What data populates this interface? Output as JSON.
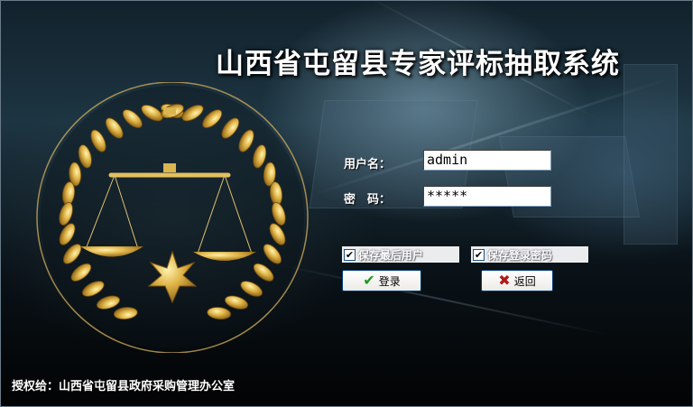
{
  "title": "山西省屯留县专家评标抽取系统",
  "form": {
    "username_label": "用户名：",
    "username_value": "admin",
    "password_label": "密　码：",
    "password_value": "*****"
  },
  "options": {
    "save_user_label": "保存最后用户",
    "save_user_checked": true,
    "save_password_label": "保存登录密码",
    "save_password_checked": true
  },
  "buttons": {
    "login_label": "登录",
    "back_label": "返回"
  },
  "footer": {
    "license_text": "授权给：山西省屯留县政府采购管理办公室"
  },
  "icons": {
    "login": "green-check-icon",
    "back": "red-x-icon",
    "emblem": "justice-scales-emblem-icon"
  },
  "colors": {
    "login_icon": "#1a9a1a",
    "back_icon": "#b01818",
    "emblem_gold": "#d4a83a"
  }
}
